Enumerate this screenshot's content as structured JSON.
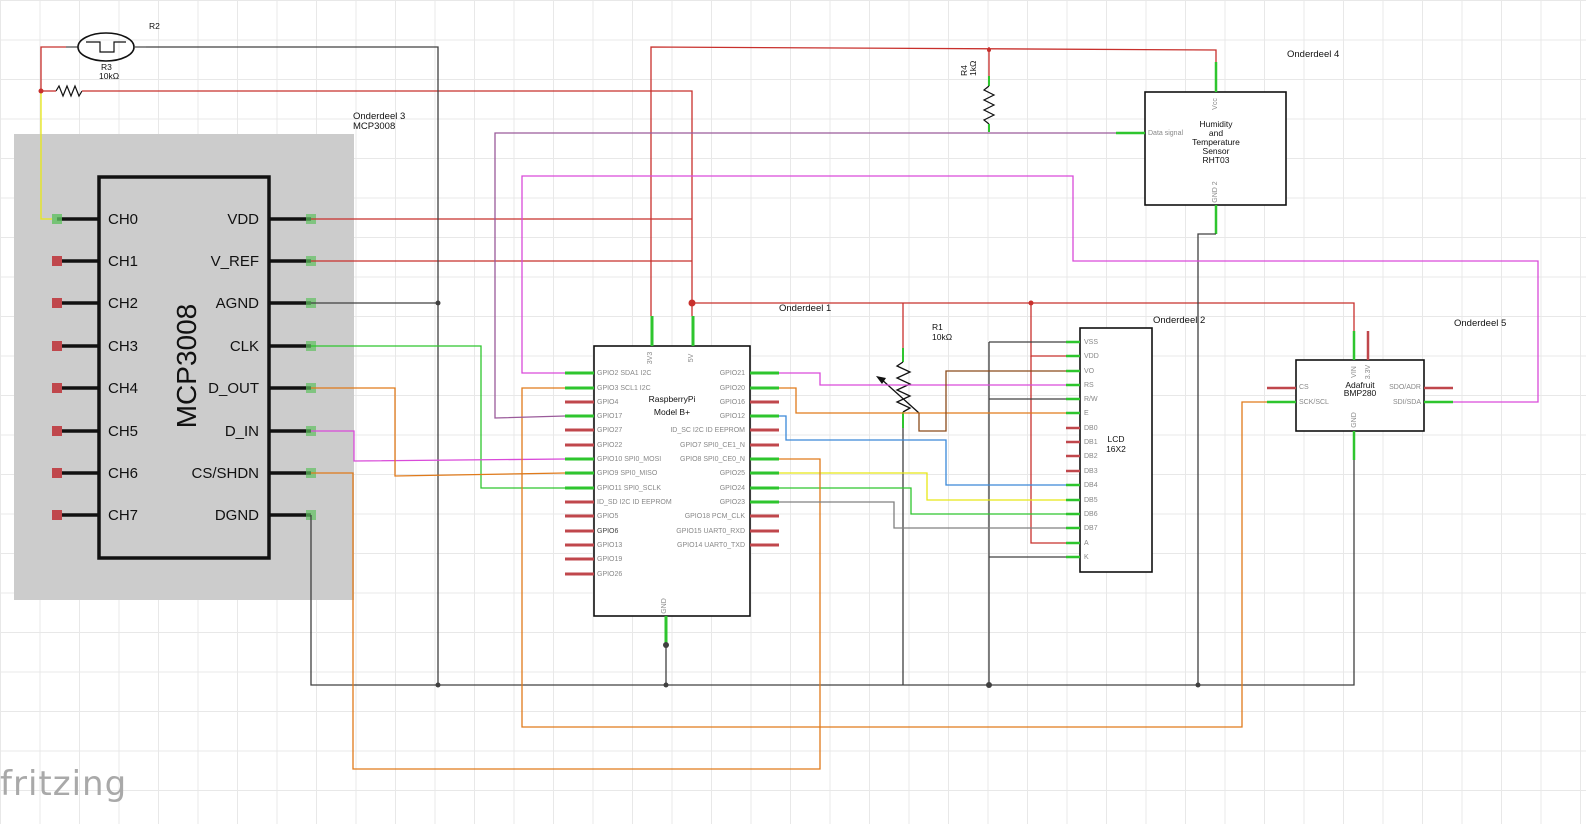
{
  "watermark": "fritzing",
  "colors": {
    "red": "#c8302c",
    "black": "#404040",
    "green": "#2ec52e",
    "magenta": "#d94ad9",
    "orange": "#e07a1a",
    "purple": "#9a5a9a",
    "yellow": "#e8e816",
    "blue": "#3a88d8",
    "brown": "#8a4a1a",
    "gray": "#808080",
    "pin_red": "#c0474c",
    "pin_green": "#60c060",
    "selection": "#cccccc"
  },
  "parts": {
    "r2": {
      "label": "R2"
    },
    "r3": {
      "label": "R3",
      "value": "10kΩ"
    },
    "r4": {
      "label": "R4",
      "value": "1kΩ"
    },
    "r1": {
      "label": "R1",
      "value": "10kΩ"
    },
    "onderdeel1": "Onderdeel 1",
    "onderdeel2": "Onderdeel 2",
    "onderdeel3": "Onderdeel 3",
    "onderdeel3_sub": "MCP3008",
    "onderdeel4": "Onderdeel 4",
    "onderdeel5": "Onderdeel 5"
  },
  "mcp3008": {
    "title": "MCP3008",
    "left_pins": [
      "CH0",
      "CH1",
      "CH2",
      "CH3",
      "CH4",
      "CH5",
      "CH6",
      "CH7"
    ],
    "right_pins": [
      "VDD",
      "V_REF",
      "AGND",
      "CLK",
      "D_OUT",
      "D_IN",
      "CS/SHDN",
      "DGND"
    ]
  },
  "raspberry_pi": {
    "title_line1": "RaspberryPi",
    "title_line2": "Model B+",
    "top_pins": [
      "3V3",
      "5V"
    ],
    "bottom_pin": "GND",
    "left_pins": [
      "GPIO2 SDA1 I2C",
      "GPIO3 SCL1 I2C",
      "GPIO4",
      "GPIO17",
      "GPIO27",
      "GPIO22",
      "GPIO10 SPI0_MOSI",
      "GPIO9 SPI0_MISO",
      "GPIO11 SPI0_SCLK",
      "ID_SD I2C ID EEPROM",
      "GPIO5",
      "GPIO6",
      "GPIO13",
      "GPIO19",
      "GPIO26"
    ],
    "right_pins": [
      "GPIO21",
      "GPIO20",
      "GPIO16",
      "GPIO12",
      "ID_SC I2C ID EEPROM",
      "GPIO7 SPI0_CE1_N",
      "GPIO8 SPI0_CE0_N",
      "GPIO25",
      "GPIO24",
      "GPIO23",
      "GPIO18 PCM_CLK",
      "GPIO15 UART0_RXD",
      "GPIO14 UART0_TXD"
    ]
  },
  "lcd": {
    "title_line1": "LCD",
    "title_line2": "16X2",
    "pins": [
      "VSS",
      "VDD",
      "VO",
      "RS",
      "R/W",
      "E",
      "DB0",
      "DB1",
      "DB2",
      "DB3",
      "DB4",
      "DB5",
      "DB6",
      "DB7",
      "A",
      "K"
    ]
  },
  "rht03": {
    "lines": [
      "Humidity",
      "and",
      "Temperature",
      "Sensor",
      "RHT03"
    ],
    "pin_vcc": "Vcc",
    "pin_data": "Data signal",
    "pin_gnd": "GND 2"
  },
  "bmp280": {
    "title_line1": "Adafruit",
    "title_line2": "BMP280",
    "pins": {
      "vin": "VIN",
      "v33": "3.3V",
      "cs": "CS",
      "sck": "SCK/SCL",
      "sdo": "SDO/ADR",
      "sdi": "SDI/SDA",
      "gnd": "GND"
    }
  }
}
